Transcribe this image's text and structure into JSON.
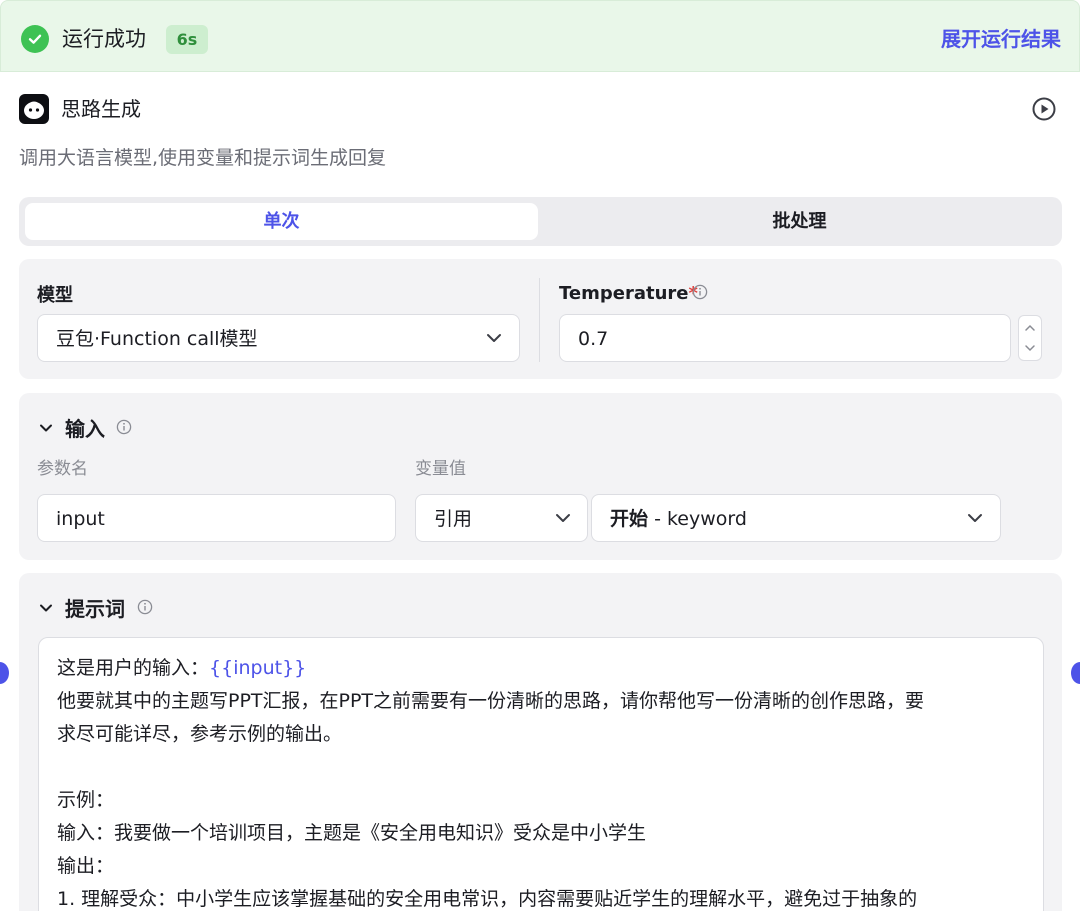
{
  "status": {
    "text": "运行成功",
    "duration": "6s",
    "expand_label": "展开运行结果",
    "icon": "check-circle-icon",
    "success_color": "#3ec254",
    "accent_color": "#4d53e8"
  },
  "node": {
    "title": "思路生成",
    "description": "调用大语言模型,使用变量和提示词生成回复",
    "icon": "llm-robot-icon",
    "run_icon": "play-circle-icon"
  },
  "tabs": [
    {
      "label": "单次",
      "active": true
    },
    {
      "label": "批处理",
      "active": false
    }
  ],
  "model": {
    "label": "模型",
    "value": "豆包·Function call模型"
  },
  "temperature": {
    "label": "Temperature",
    "required_mark": "*",
    "value": "0.7"
  },
  "input_section": {
    "title": "输入",
    "param_name_label": "参数名",
    "var_value_label": "变量值",
    "param_name": "input",
    "ref_type": "引用",
    "ref_source": "开始",
    "ref_separator": "-",
    "ref_var": "keyword"
  },
  "prompt_section": {
    "title": "提示词",
    "line1_prefix": "这是用户的输入：",
    "line1_var": "{{input}}",
    "lines": [
      "他要就其中的主题写PPT汇报，在PPT之前需要有一份清晰的思路，请你帮他写一份清晰的创作思路，要",
      "求尽可能详尽，参考示例的输出。",
      "",
      "示例：",
      "输入：我要做一个培训项目，主题是《安全用电知识》受众是中小学生",
      "输出：",
      "1. 理解受众：中小学生应该掌握基础的安全用电常识，内容需要贴近学生的理解水平，避免过于抽象的"
    ]
  }
}
